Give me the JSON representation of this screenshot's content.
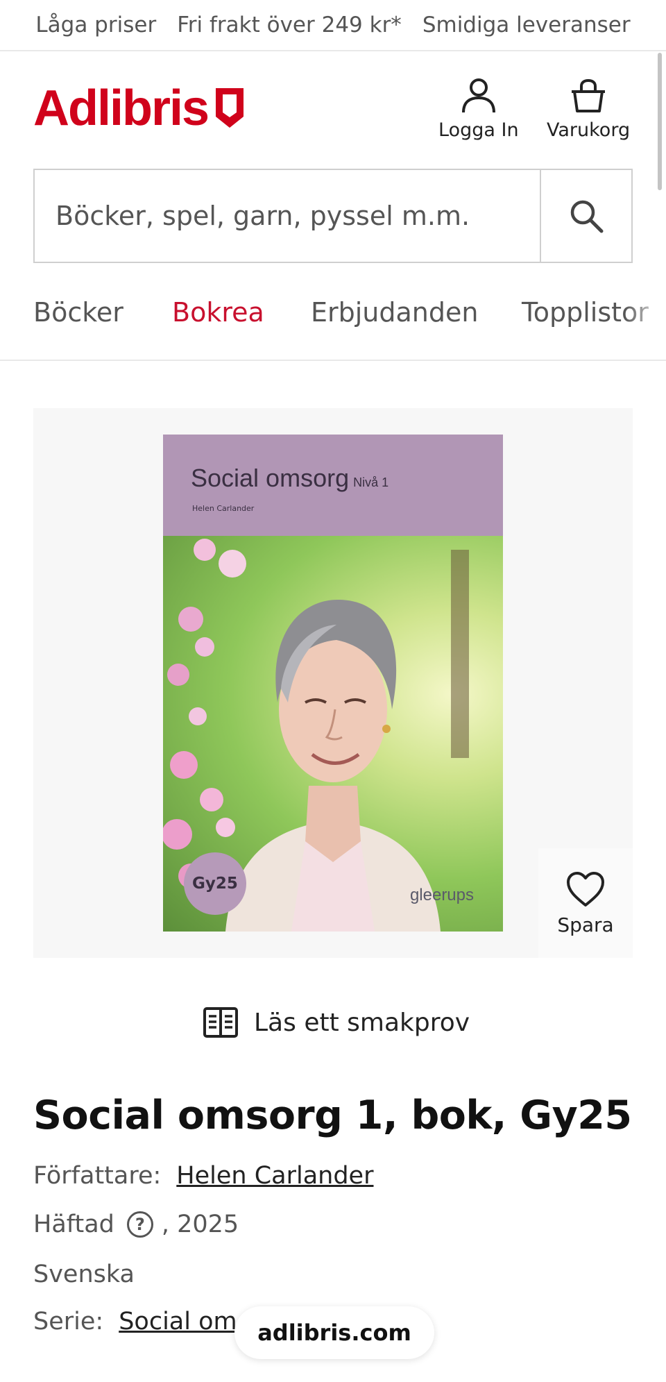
{
  "usp_bar": {
    "items": [
      "Låga priser",
      "Fri frakt över 249 kr*",
      "Smidiga leveranser"
    ]
  },
  "header": {
    "logo_text": "Adlibris",
    "login_label": "Logga In",
    "cart_label": "Varukorg"
  },
  "search": {
    "placeholder": "Böcker, spel, garn, pyssel m.m."
  },
  "category_nav": {
    "items": [
      {
        "label": "Böcker",
        "active": false
      },
      {
        "label": "Bokrea",
        "active": true
      },
      {
        "label": "Erbjudanden",
        "active": false
      },
      {
        "label": "Topplistor",
        "active": false
      }
    ]
  },
  "product_cover": {
    "title": "Social omsorg",
    "level": "Nivå 1",
    "author": "Helen Carlander",
    "badge": "Gy25",
    "publisher": "gleerups"
  },
  "actions": {
    "save_label": "Spara",
    "sample_label": "Läs ett smakprov"
  },
  "product": {
    "title": "Social omsorg 1, bok, Gy25",
    "author_label": "Författare:",
    "author_name": "Helen Carlander",
    "binding": "Häftad",
    "year": ", 2025",
    "language": "Svenska",
    "series_label": "Serie:",
    "series_name": "Social om"
  },
  "browser": {
    "url": "adlibris.com"
  },
  "colors": {
    "brand_red": "#d0021b",
    "active_nav": "#c8102e",
    "cover_band": "#b196b5"
  }
}
